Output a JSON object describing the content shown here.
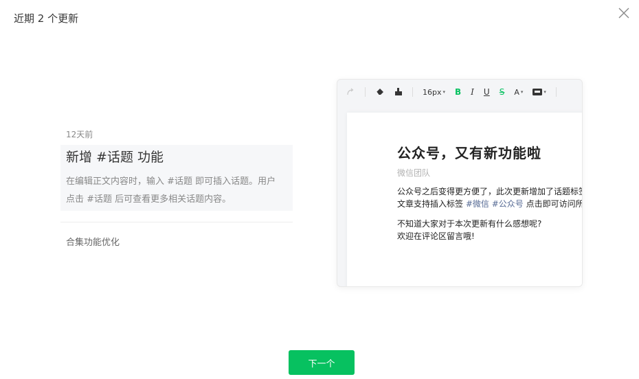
{
  "dialog": {
    "title": "近期 2 个更新",
    "next_label": "下一个"
  },
  "updates": [
    {
      "date": "12天前",
      "title": "新增 #话题 功能",
      "description": "在编辑正文内容时，输入 #话题 即可插入话题。用户点击 #话题 后可查看更多相关话题内容。"
    },
    {
      "title": "合集功能优化"
    }
  ],
  "preview": {
    "toolbar": {
      "font_size": "16px",
      "bold": "B",
      "italic": "I",
      "underline": "U",
      "strike": "S",
      "font_color": "A"
    },
    "article": {
      "title": "公众号，又有新功能啦",
      "author": "微信团队",
      "para1_line1": "公众号之后变得更方便了，此次更新增加了话题标签",
      "para1_line2_prefix": "文章支持插入标签 ",
      "tag1": "#微信",
      "tag2": "#公众号",
      "para1_line2_suffix": " 点击即可访问所有",
      "para2_line1": "不知道大家对于本次更新有什么感想呢?",
      "para2_line2": "欢迎在评论区留言哦!"
    }
  },
  "colors": {
    "accent": "#07c160",
    "tag": "#576b95",
    "muted": "#888888"
  }
}
